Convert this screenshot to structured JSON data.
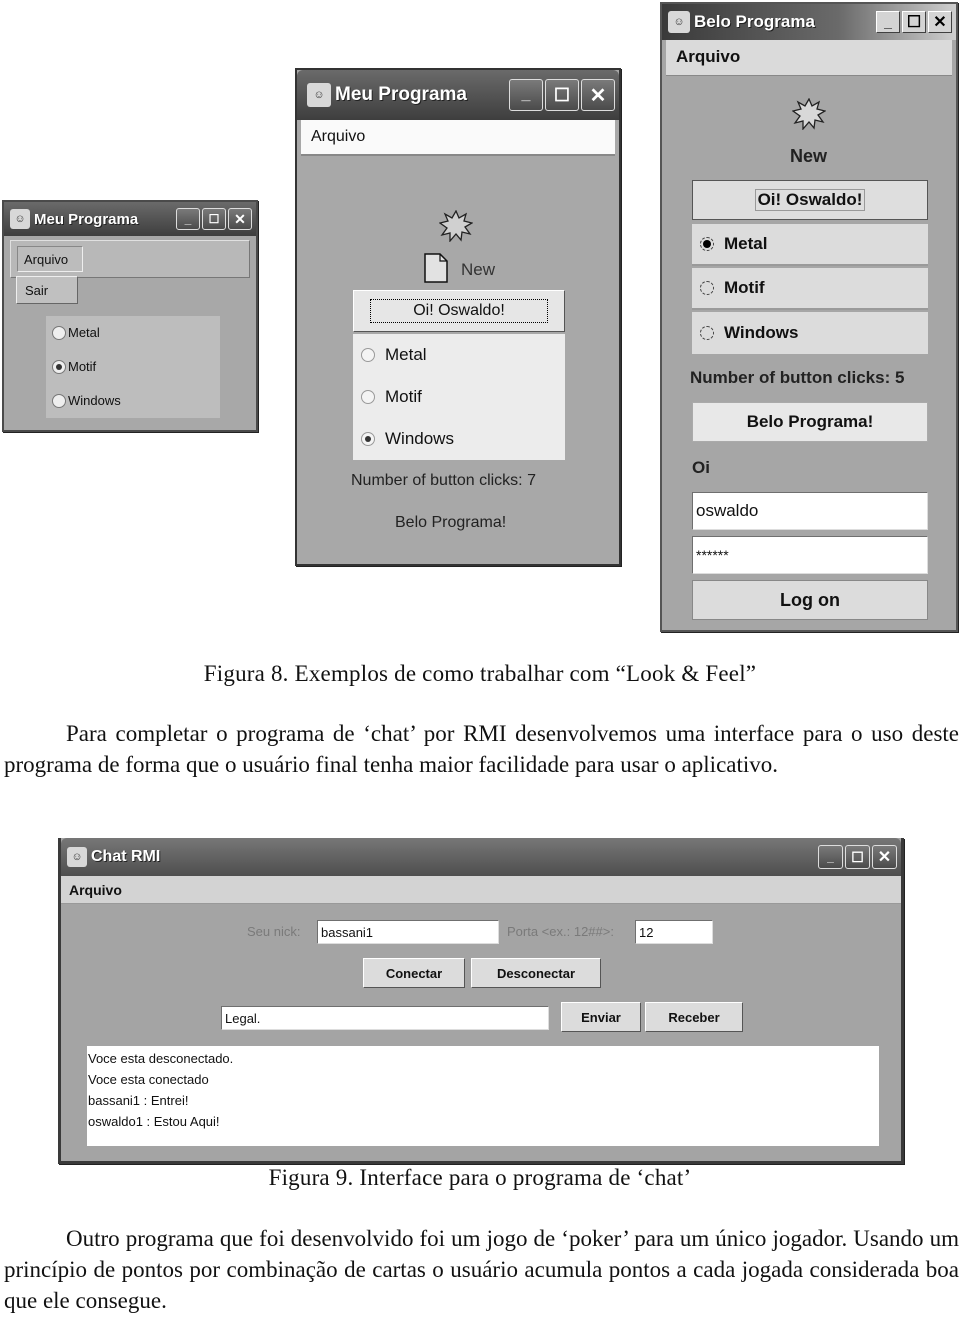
{
  "figure8": {
    "window_small": {
      "title": "Meu Programa",
      "menu": "Arquivo",
      "menu_open_item": "Sair",
      "radios": [
        {
          "label": "Metal",
          "checked": false
        },
        {
          "label": "Motif",
          "checked": true
        },
        {
          "label": "Windows",
          "checked": false
        }
      ]
    },
    "window_windows": {
      "title": "Meu Programa",
      "menu": "Arquivo",
      "icon_label": "New",
      "button": "Oi! Oswaldo!",
      "radios": [
        {
          "label": "Metal",
          "checked": false
        },
        {
          "label": "Motif",
          "checked": false
        },
        {
          "label": "Windows",
          "checked": true
        }
      ],
      "clicks_text": "Number of button clicks: 7",
      "bottom_label": "Belo Programa!"
    },
    "window_metal": {
      "title": "Belo Programa",
      "menu": "Arquivo",
      "icon_label": "New",
      "button": "Oi! Oswaldo!",
      "radios": [
        {
          "label": "Metal",
          "checked": true
        },
        {
          "label": "Motif",
          "checked": false
        },
        {
          "label": "Windows",
          "checked": false
        }
      ],
      "clicks_text": "Number of button clicks: 5",
      "belo_button": "Belo Programa!",
      "oi_label": "Oi",
      "username_value": "oswaldo",
      "password_value": "******",
      "logon_button": "Log on"
    },
    "caption": "Figura 8. Exemplos de como trabalhar com “Look & Feel”"
  },
  "paragraph1": "Para completar o programa de ‘chat’ por RMI desenvolvemos uma interface para o uso deste programa de forma que o usuário final tenha maior facilidade para usar o aplicativo.",
  "figure9": {
    "window": {
      "title": "Chat RMI",
      "menu": "Arquivo",
      "nick_label": "Seu nick:",
      "nick_value": "bassani1",
      "port_label": "Porta <ex.: 12##>:",
      "port_value": "12",
      "connect_button": "Conectar",
      "disconnect_button": "Desconectar",
      "message_value": "Legal.",
      "send_button": "Enviar",
      "receive_button": "Receber",
      "log_lines": [
        "Voce esta desconectado.",
        "Voce esta conectado",
        "bassani1 : Entrei!",
        "oswaldo1 : Estou Aqui!"
      ]
    },
    "caption": "Figura 9. Interface para o programa de ‘chat’"
  },
  "paragraph2": "Outro programa que foi desenvolvido foi um jogo de ‘poker’ para um único jogador. Usando um princípio de pontos por combinação de cartas o usuário acumula pontos a cada jogada considerada boa que ele consegue."
}
